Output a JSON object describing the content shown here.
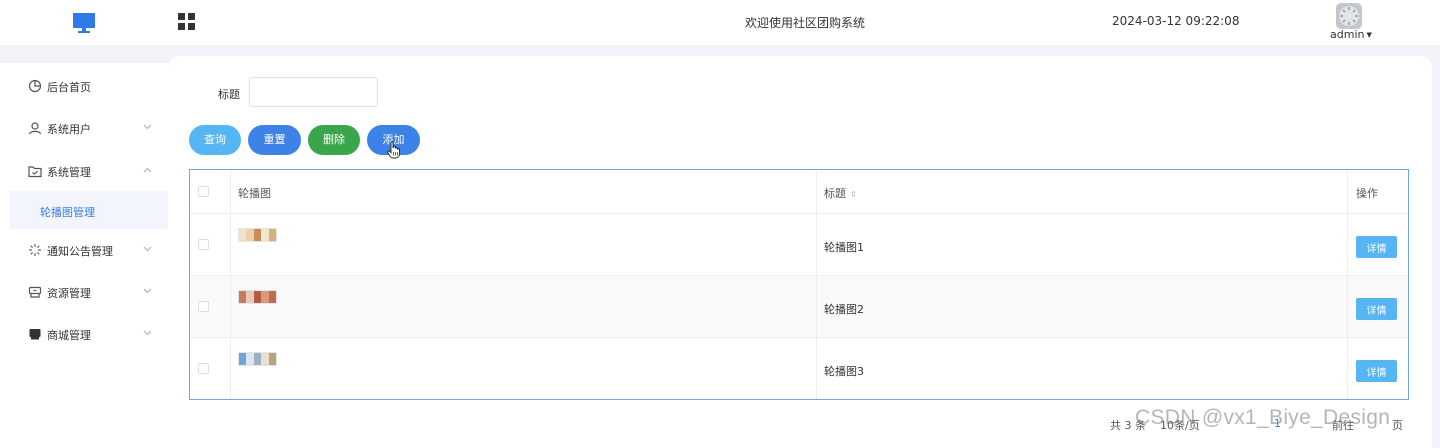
{
  "header": {
    "title": "欢迎使用社区团购系统",
    "datetime": "2024-03-12 09:22:08",
    "user": "admin"
  },
  "sidebar": {
    "items": [
      {
        "label": "后台首页",
        "icon": "clock-icon",
        "expanded": null
      },
      {
        "label": "系统用户",
        "icon": "user-icon",
        "expanded": false
      },
      {
        "label": "系统管理",
        "icon": "folder-icon",
        "expanded": true
      },
      {
        "label": "通知公告管理",
        "icon": "sparkle-icon",
        "expanded": false
      },
      {
        "label": "资源管理",
        "icon": "box-icon",
        "expanded": false
      },
      {
        "label": "商城管理",
        "icon": "shop-icon",
        "expanded": false
      }
    ],
    "active_sub": "轮播图管理"
  },
  "search": {
    "label": "标题",
    "value": "",
    "placeholder": ""
  },
  "toolbar": {
    "query": "查询",
    "reset": "重置",
    "delete": "删除",
    "add": "添加"
  },
  "table": {
    "columns": [
      "轮播图",
      "标题",
      "操作"
    ],
    "rows": [
      {
        "title": "轮播图1",
        "action": "详情"
      },
      {
        "title": "轮播图2",
        "action": "详情"
      },
      {
        "title": "轮播图3",
        "action": "详情"
      }
    ]
  },
  "pagination": {
    "total_prefix": "共 3 条",
    "page_size": "10条/页",
    "current_page": "1",
    "goto": "前往",
    "page_suffix": "页"
  },
  "watermark": "CSDN @vx1_Biye_Design",
  "colors": {
    "accent": "#3d82e6",
    "info": "#55b6f3",
    "success": "#3aa54a",
    "table_border": "#6fa6e8"
  }
}
